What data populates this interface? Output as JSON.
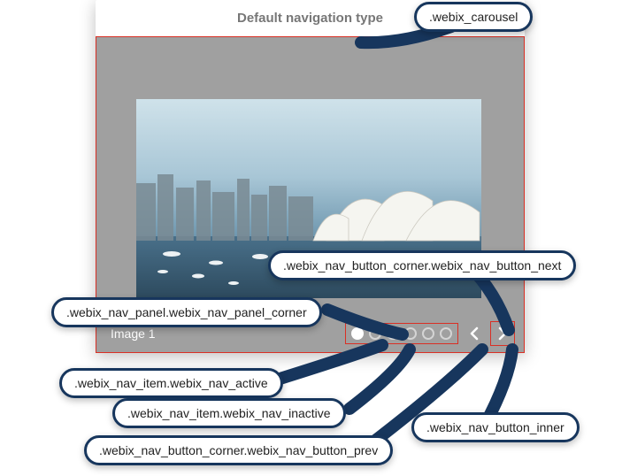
{
  "title": "Default navigation type",
  "image_label": "Image 1",
  "nav_items": [
    {
      "active": true
    },
    {
      "active": false
    },
    {
      "active": false
    },
    {
      "active": false
    },
    {
      "active": false
    },
    {
      "active": false
    }
  ],
  "callouts": {
    "carousel": ".webix_carousel",
    "next": ".webix_nav_button_corner.webix_nav_button_next",
    "panel": ".webix_nav_panel.webix_nav_panel_corner",
    "active_item": ".webix_nav_item.webix_nav_active",
    "inactive_item": ".webix_nav_item.webix_nav_inactive",
    "inner": ".webix_nav_button_inner",
    "prev": ".webix_nav_button_corner.webix_nav_button_prev"
  }
}
